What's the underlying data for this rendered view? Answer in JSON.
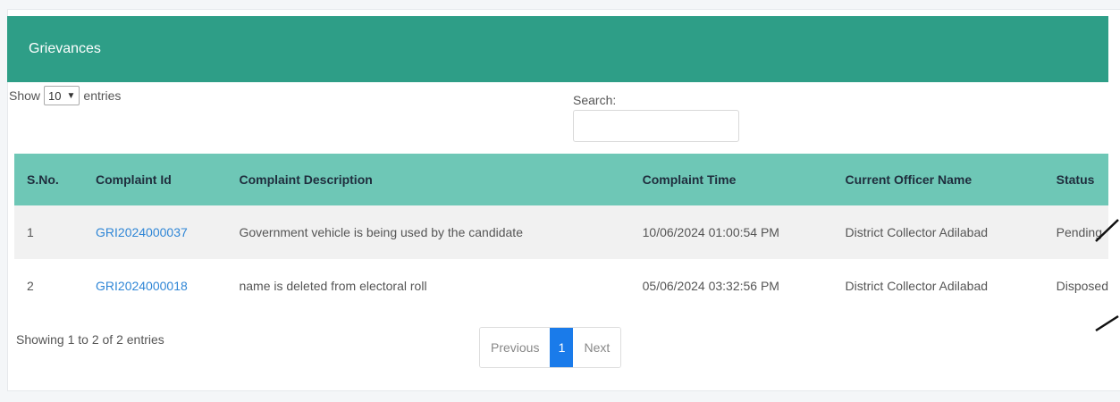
{
  "panel": {
    "title": "Grievances"
  },
  "length": {
    "show_label": "Show",
    "value": "10",
    "entries_label": "entries"
  },
  "search": {
    "label": "Search:",
    "value": ""
  },
  "table": {
    "headers": [
      "S.No.",
      "Complaint Id",
      "Complaint Description",
      "Complaint Time",
      "Current Officer Name",
      "Status"
    ],
    "rows": [
      {
        "sno": "1",
        "id": "GRI2024000037",
        "description": "Government vehicle is being used by the candidate",
        "time": "10/06/2024 01:00:54 PM",
        "officer": "District Collector Adilabad",
        "status": "Pending"
      },
      {
        "sno": "2",
        "id": "GRI2024000018",
        "description": "name is deleted from electoral roll",
        "time": "05/06/2024 03:32:56 PM",
        "officer": "District Collector Adilabad",
        "status": "Disposed"
      }
    ]
  },
  "info": "Showing 1 to 2 of 2 entries",
  "pagination": {
    "previous": "Previous",
    "current": "1",
    "next": "Next"
  },
  "colors": {
    "header": "#2e9e87",
    "table_header": "#6ec7b6",
    "link": "#2f86d6",
    "active_page": "#1a7bea"
  }
}
